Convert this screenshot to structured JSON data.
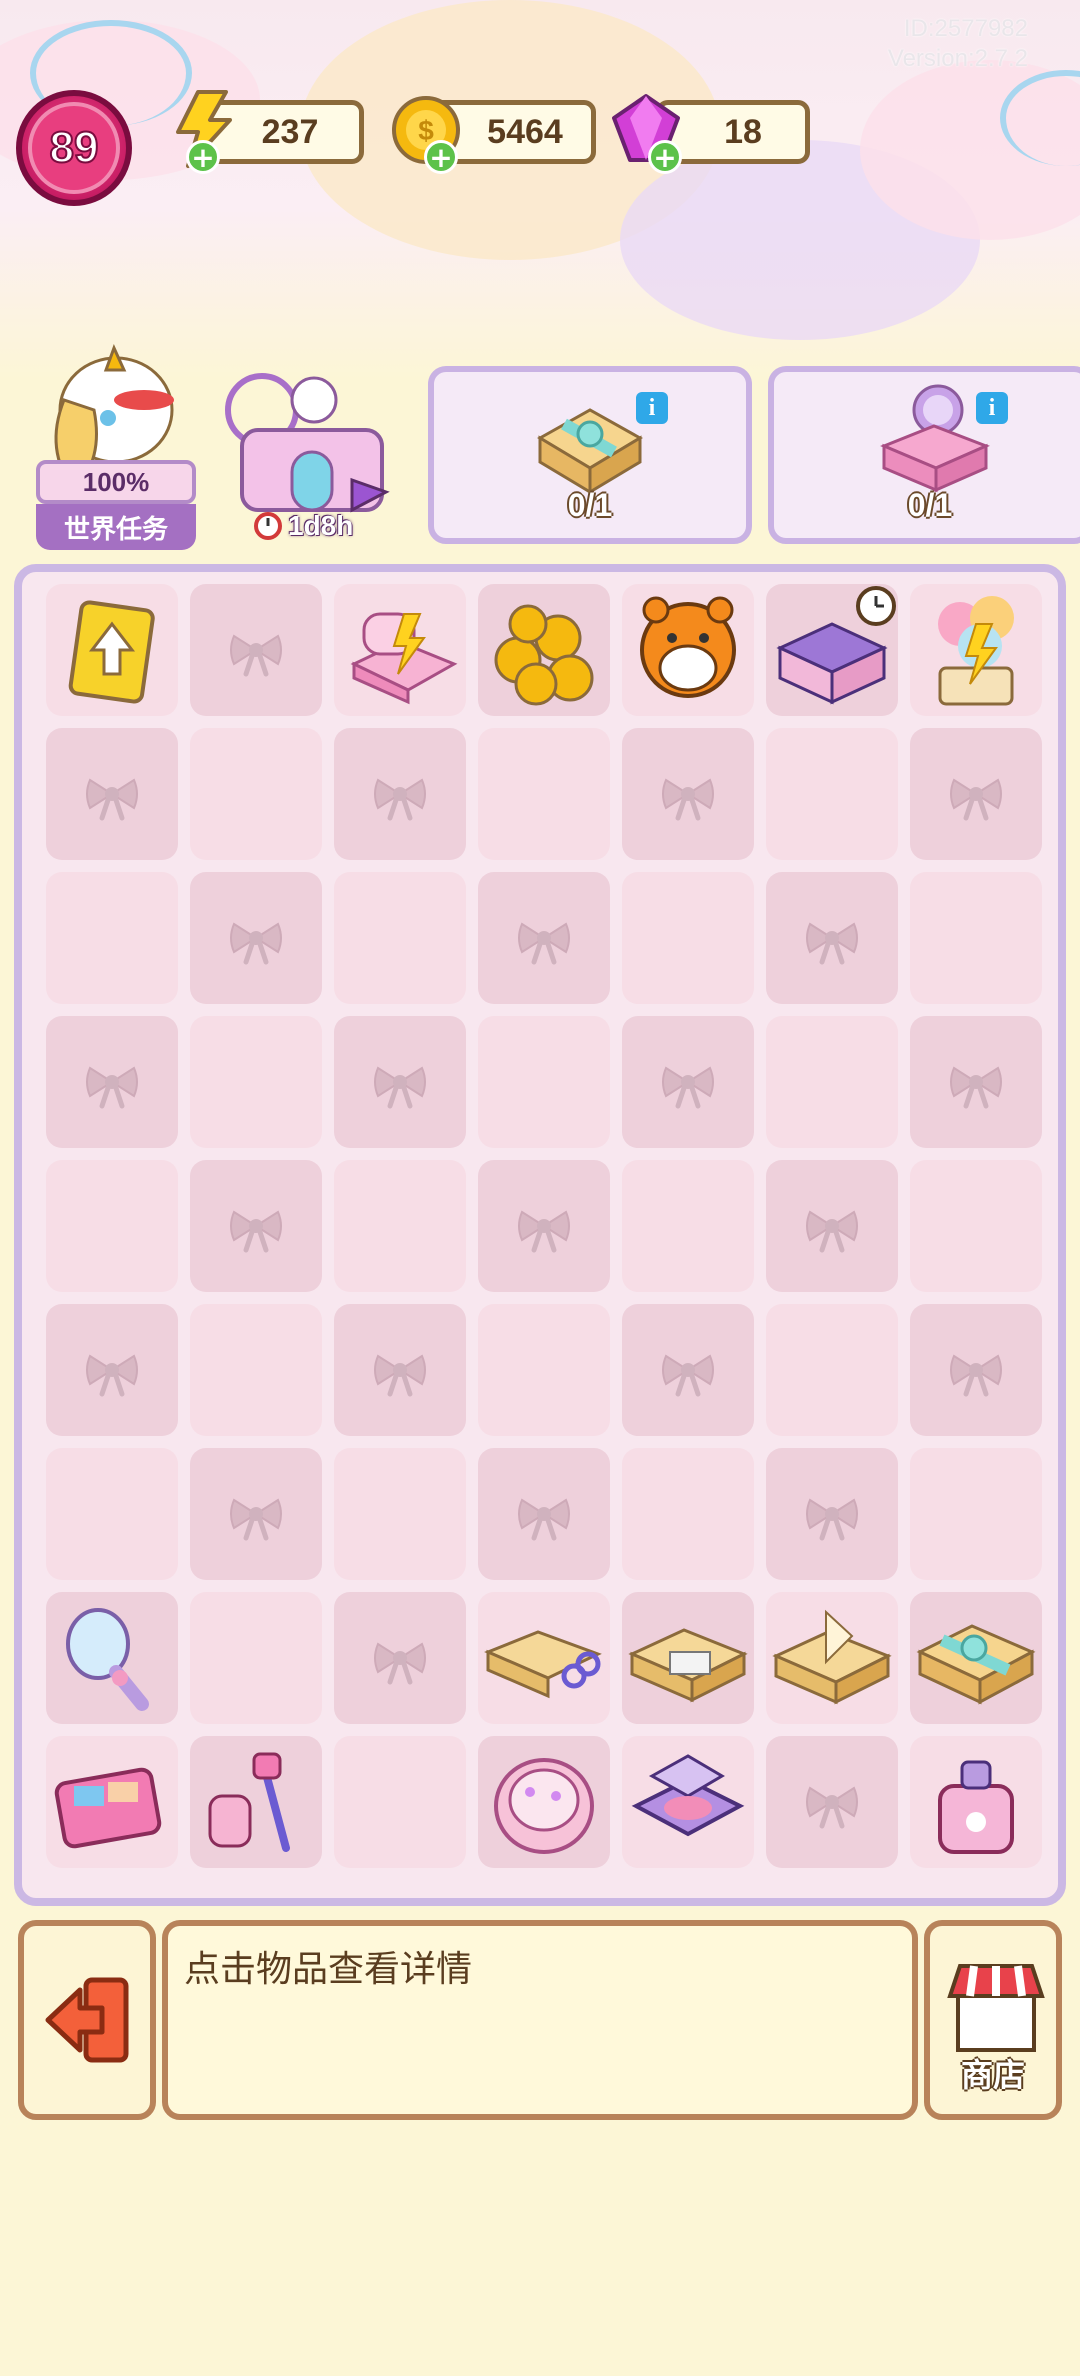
{
  "header": {
    "id_text": "ID:2577982",
    "version_text": "Version:2.7.2",
    "level": "89",
    "energy": "237",
    "coins": "5464",
    "gems": "18"
  },
  "hero": {
    "progress": "100%",
    "title": "世界任务"
  },
  "event": {
    "timer": "1d8h"
  },
  "orders": [
    {
      "count": "0/1",
      "icon": "gift-box-icon"
    },
    {
      "count": "0/1",
      "icon": "vanity-table-icon"
    }
  ],
  "board": {
    "columns": 7,
    "rows": 9,
    "items": {
      "0-0": "upgrade-card",
      "0-2": "pink-bed-energy",
      "0-3": "gold-coins",
      "0-4": "hamburger-mascot",
      "0-5": "purple-house",
      "0-6": "balloon-energy",
      "7-0": "hand-mirror",
      "7-3": "craft-box-scissors",
      "7-4": "craft-box-eraser",
      "7-5": "craft-box-paper",
      "7-6": "gift-box-ribbon",
      "8-0": "eyeshadow-palette",
      "8-1": "roller-brush",
      "8-3": "powder-compact",
      "8-4": "blush-compact",
      "8-6": "perfume-bottle"
    }
  },
  "footer": {
    "info_text": "点击物品查看详情",
    "shop_label": "商店"
  },
  "colors": {
    "board_border": "#cbb8e4",
    "panel_border": "#b8835a",
    "level_badge": "#e83e7f"
  }
}
